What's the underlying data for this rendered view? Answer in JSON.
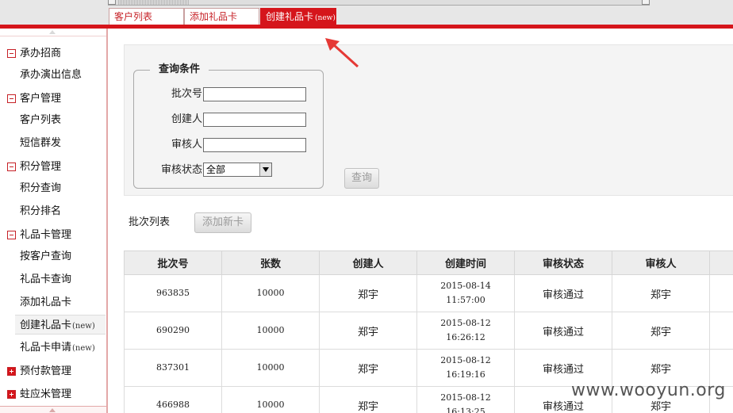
{
  "tabs": [
    {
      "label": "客户列表",
      "tag": ""
    },
    {
      "label": "添加礼品卡",
      "tag": ""
    },
    {
      "label": "创建礼品卡",
      "tag": "(new)"
    }
  ],
  "sidebar": {
    "groups": [
      {
        "label": "承办招商",
        "items": [
          {
            "label": "承办演出信息",
            "tag": ""
          }
        ]
      },
      {
        "label": "客户管理",
        "items": [
          {
            "label": "客户列表",
            "tag": ""
          },
          {
            "label": "短信群发",
            "tag": ""
          }
        ]
      },
      {
        "label": "积分管理",
        "items": [
          {
            "label": "积分查询",
            "tag": ""
          },
          {
            "label": "积分排名",
            "tag": ""
          }
        ]
      },
      {
        "label": "礼品卡管理",
        "items": [
          {
            "label": "按客户查询",
            "tag": ""
          },
          {
            "label": "礼品卡查询",
            "tag": ""
          },
          {
            "label": "添加礼品卡",
            "tag": ""
          },
          {
            "label": "创建礼品卡",
            "tag": "(new)"
          },
          {
            "label": "礼品卡申请",
            "tag": "(new)"
          }
        ]
      },
      {
        "label": "预付款管理",
        "items": []
      },
      {
        "label": "蛀应米管理",
        "items": []
      }
    ]
  },
  "query": {
    "legend": "查询条件",
    "fields": [
      {
        "label": "批次号",
        "value": ""
      },
      {
        "label": "创建人",
        "value": ""
      },
      {
        "label": "审核人",
        "value": ""
      }
    ],
    "status_label": "审核状态",
    "status_value": "全部",
    "button_label": "查询"
  },
  "list": {
    "title": "批次列表",
    "add_button_label": "添加新卡",
    "columns": [
      "批次号",
      "张数",
      "创建人",
      "创建时间",
      "审核状态",
      "审核人"
    ],
    "rows": [
      {
        "batch_no": "963835",
        "count": "10000",
        "creator": "郑宇",
        "date": "2015-08-14",
        "time": "11:57:00",
        "status": "审核通过",
        "reviewer": "郑宇"
      },
      {
        "batch_no": "690290",
        "count": "10000",
        "creator": "郑宇",
        "date": "2015-08-12",
        "time": "16:26:12",
        "status": "审核通过",
        "reviewer": "郑宇"
      },
      {
        "batch_no": "837301",
        "count": "10000",
        "creator": "郑宇",
        "date": "2015-08-12",
        "time": "16:19:16",
        "status": "审核通过",
        "reviewer": "郑宇"
      },
      {
        "batch_no": "466988",
        "count": "10000",
        "creator": "郑宇",
        "date": "2015-08-12",
        "time": "16:13:25",
        "status": "审核通过",
        "reviewer": "郑宇"
      }
    ]
  },
  "watermark": "www.wooyun.org",
  "colors": {
    "accent": "#d5151b",
    "annotation": "#e53935"
  }
}
